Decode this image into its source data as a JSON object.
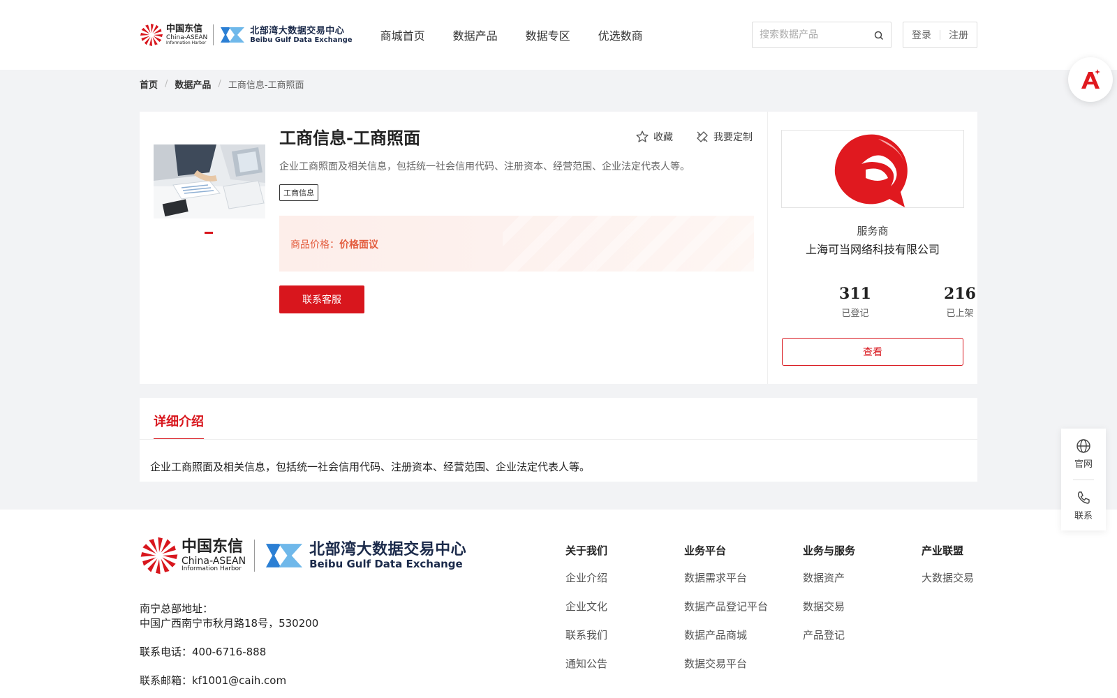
{
  "header": {
    "logo_cn": {
      "title": "中国东信",
      "line2": "China-ASEAN",
      "line3": "Information Harbor"
    },
    "logo_bb": {
      "title": "北部湾大数据交易中心",
      "subtitle": "Beibu Gulf Data Exchange"
    },
    "nav": [
      "商城首页",
      "数据产品",
      "数据专区",
      "优选数商"
    ],
    "search_placeholder": "搜索数据产品",
    "login": "登录",
    "register": "注册"
  },
  "breadcrumb": {
    "home": "首页",
    "category": "数据产品",
    "current": "工商信息-工商照面"
  },
  "product": {
    "title": "工商信息-工商照面",
    "favorite": "收藏",
    "customize": "我要定制",
    "description": "企业工商照面及相关信息，包括统一社会信用代码、注册资本、经营范围、企业法定代表人等。",
    "tag": "工商信息",
    "price_label": "商品价格：",
    "price_value": "价格面议",
    "contact_button": "联系客服"
  },
  "provider": {
    "label": "服务商",
    "name": "上海可当网络科技有限公司",
    "registered_count": "311",
    "registered_label": "已登记",
    "listed_count": "216",
    "listed_label": "已上架",
    "view_button": "查看"
  },
  "detail": {
    "tab": "详细介绍",
    "body": "企业工商照面及相关信息，包括统一社会信用代码、注册资本、经营范围、企业法定代表人等。"
  },
  "footer": {
    "logo_cn": {
      "title": "中国东信",
      "line2": "China-ASEAN",
      "line3": "Information Harbor"
    },
    "logo_bb": {
      "title": "北部湾大数据交易中心",
      "subtitle": "Beibu Gulf Data Exchange"
    },
    "address_label": "南宁总部地址：",
    "address": "中国广西南宁市秋月路18号，530200",
    "phone": "联系电话：400-6716-888",
    "email": "联系邮箱：kf1001@caih.com",
    "columns": [
      {
        "title": "关于我们",
        "items": [
          "企业介绍",
          "企业文化",
          "联系我们",
          "通知公告"
        ]
      },
      {
        "title": "业务平台",
        "items": [
          "数据需求平台",
          "数据产品登记平台",
          "数据产品商城",
          "数据交易平台"
        ]
      },
      {
        "title": "业务与服务",
        "items": [
          "数据资产",
          "数据交易",
          "产品登记"
        ]
      },
      {
        "title": "产业联盟",
        "items": [
          "大数据交易"
        ]
      }
    ]
  },
  "float": {
    "website": "官网",
    "contact": "联系"
  },
  "colors": {
    "accent": "#d8161d",
    "price_text": "#e35b3c",
    "brand_blue": "#1b2a4a"
  }
}
